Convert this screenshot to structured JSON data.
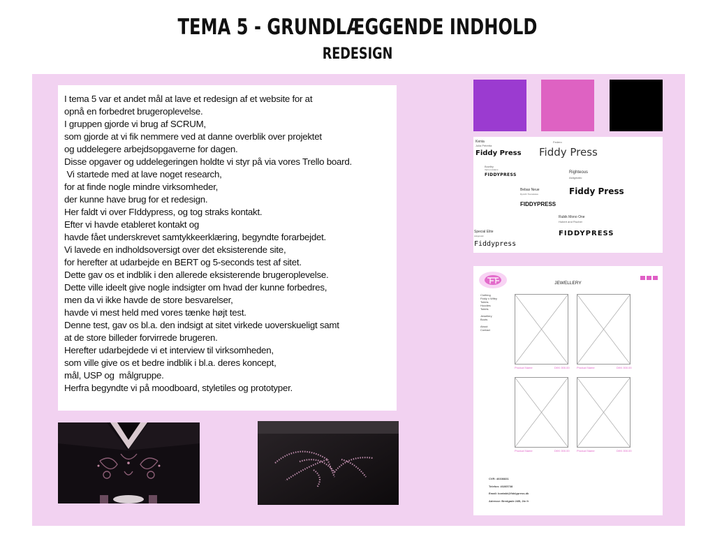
{
  "header": {
    "title": "TEMA 5 - GRUNDLÆGGENDE INDHOLD",
    "subtitle": "REDESIGN"
  },
  "body_text": [
    "I tema 5 var et andet mål at lave et redesign af et website for at",
    "opnå en forbedret brugeroplevelse.",
    "I gruppen gjorde vi brug af SCRUM,",
    "som gjorde at vi fik nemmere ved at danne overblik over projektet",
    "og uddelegere arbejdsopgaverne for dagen.",
    "Disse opgaver og uddelegeringen holdte vi styr på via vores Trello board.",
    " Vi startede med at lave noget research,",
    "for at finde nogle mindre virksomheder,",
    "der kunne have brug for et redesign.",
    "Her faldt vi over FIddypress, og tog straks kontakt.",
    "Efter vi havde etableret kontakt og",
    "havde fået underskrevet samtykkeerklæring, begyndte forarbejdet.",
    "Vi lavede en indholdsoversigt over det eksisterende site,",
    "for herefter at udarbejde en BERT og 5-seconds test af sitet.",
    "Dette gav os et indblik i den allerede eksisterende brugeroplevelse.",
    "Dette ville ideelt give nogle indsigter om hvad der kunne forbedres,",
    "men da vi ikke havde de store besvarelser,",
    "havde vi mest held med vores tænke højt test.",
    "Denne test, gav os bl.a. den indsigt at sitet virkede uoverskueligt samt",
    "at de store billeder forvirrede brugeren.",
    "Herefter udarbejdede vi et interview til virksomheden,",
    "som ville give os et bedre indblik i bl.a. deres koncept,",
    "mål, USP og  målgruppe.",
    "Herfra begyndte vi på moodboard, styletiles og prototyper."
  ],
  "palette": [
    "#9b3bd0",
    "#de62c2",
    "#000000"
  ],
  "typography": {
    "fonts": [
      {
        "name": "Kenia",
        "author": "Julia Petretta",
        "sample": "Fiddy Press"
      },
      {
        "name": "Fiddy Press",
        "author": "Federo",
        "sample": "Fiddy Press"
      },
      {
        "name": "Bowlby",
        "author": "Vernon Adams",
        "sample": "FIDDYPRESS"
      },
      {
        "name": "Righteous",
        "author": "Astigmatic",
        "sample": "Fiddy Press"
      },
      {
        "name": "Bebas Neue",
        "author": "Ryoichi Tsunekawa",
        "sample": "FIDDYPRESS"
      },
      {
        "name": "Rubik Mono One",
        "author": "Hubert and Fischer",
        "sample": "FIDDYPRESS"
      },
      {
        "name": "Special Elite",
        "author": "Astigmatic",
        "sample": "Fiddypress"
      }
    ]
  },
  "wireframe": {
    "heading": "JEWELLERY",
    "nav": [
      "Clothing",
      "Fiddy x Wifey",
      "Tshirts",
      "Hoodies",
      "Tshirts",
      "",
      "Jewellery",
      "Boots",
      "",
      "About",
      "Contact"
    ],
    "products": [
      {
        "left": "Product Name",
        "right": "DKK 000.00"
      },
      {
        "left": "Product Name",
        "right": "DKK 000.00"
      },
      {
        "left": "Product Name",
        "right": "DKK 000.00"
      },
      {
        "left": "Product Name",
        "right": "DKK 000.00"
      }
    ],
    "footer": [
      "CVR: 40336831",
      "Telefon: 40265738",
      "Email: kontakt@fiddypress.dk",
      "Adresse: Bredgade 24B, 2tv fr"
    ]
  },
  "colors": {
    "panel": "#f2d2f1",
    "accent_pink": "#e05fc6"
  }
}
